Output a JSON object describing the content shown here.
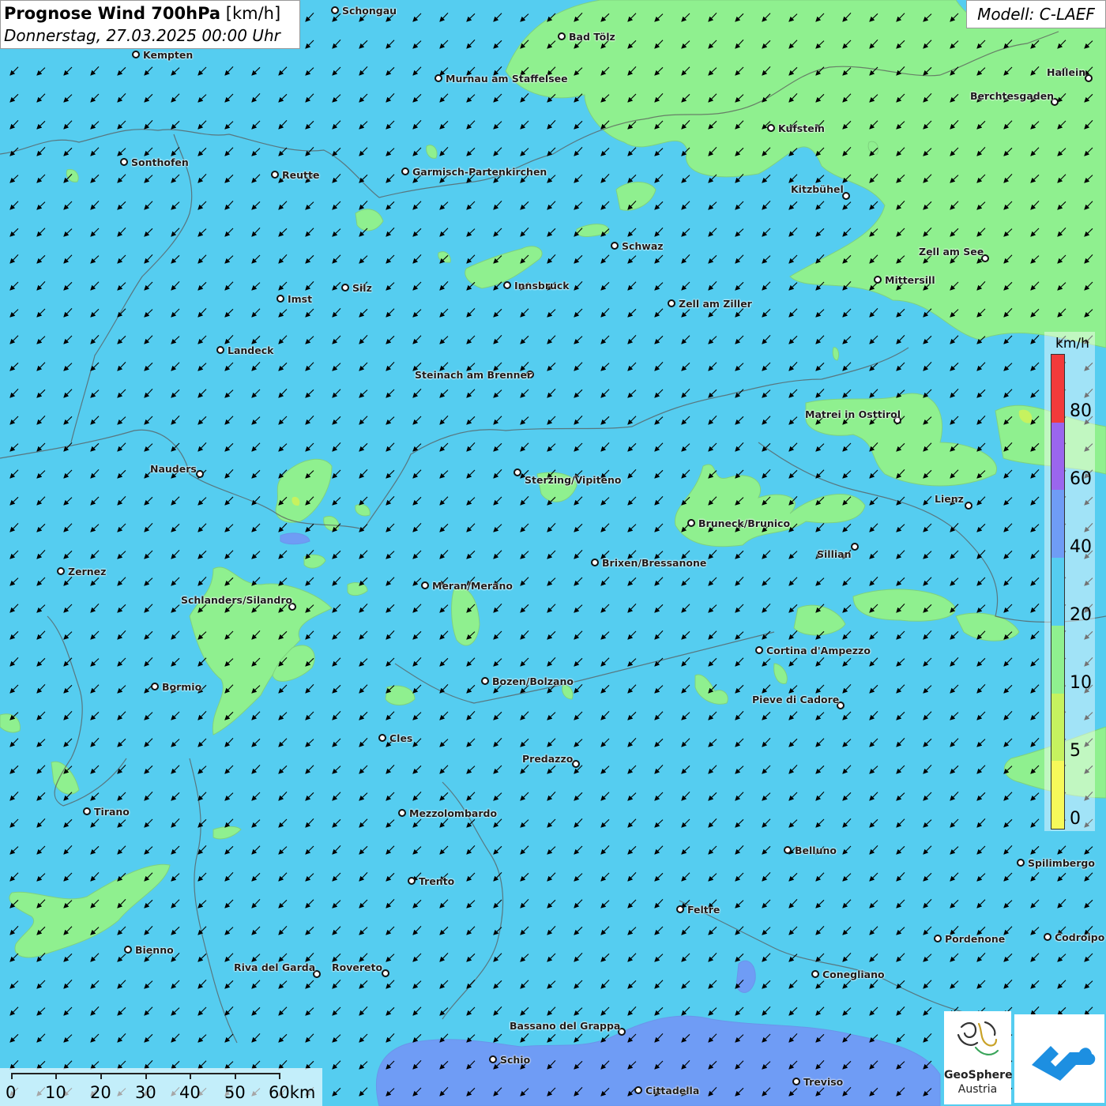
{
  "header": {
    "title": "Prognose Wind 700hPa",
    "unit": "[km/h]",
    "datetime": "Donnerstag, 27.03.2025 00:00 Uhr"
  },
  "model_label": "Modell: C-LAEF",
  "legend": {
    "unit": "km/h",
    "labels": [
      "80",
      "60",
      "40",
      "20",
      "10",
      "5",
      "0"
    ],
    "classes": [
      {
        "from": 0,
        "to": 5,
        "color": "#f6f95a"
      },
      {
        "from": 5,
        "to": 10,
        "color": "#c6f25f"
      },
      {
        "from": 10,
        "to": 20,
        "color": "#8ff08f"
      },
      {
        "from": 20,
        "to": 40,
        "color": "#55cdf0"
      },
      {
        "from": 40,
        "to": 60,
        "color": "#6f9cf5"
      },
      {
        "from": 60,
        "to": 80,
        "color": "#9a66ee"
      },
      {
        "from": 80,
        "to": 100,
        "color": "#f23a3a"
      }
    ]
  },
  "wind": {
    "background_class_kmh": "20-40",
    "prevailing_direction": "from north-east (arrows pointing south-west)"
  },
  "cities": [
    {
      "name": "Schongau"
    },
    {
      "name": "Bad Tölz"
    },
    {
      "name": "Kempten"
    },
    {
      "name": "Murnau am Staffelsee"
    },
    {
      "name": "Hallein"
    },
    {
      "name": "Berchtesgaden"
    },
    {
      "name": "Kufstein"
    },
    {
      "name": "Sonthofen"
    },
    {
      "name": "Reutte"
    },
    {
      "name": "Garmisch-Partenkirchen"
    },
    {
      "name": "Kitzbühel"
    },
    {
      "name": "Schwaz"
    },
    {
      "name": "Zell am See"
    },
    {
      "name": "Mittersill"
    },
    {
      "name": "Innsbruck"
    },
    {
      "name": "Silz"
    },
    {
      "name": "Imst"
    },
    {
      "name": "Zell am Ziller"
    },
    {
      "name": "Landeck"
    },
    {
      "name": "Steinach am Brenner"
    },
    {
      "name": "Matrei in Osttirol"
    },
    {
      "name": "Nauders"
    },
    {
      "name": "Sterzing/Vipiteno"
    },
    {
      "name": "Lienz"
    },
    {
      "name": "Bruneck/Brunico"
    },
    {
      "name": "Sillian"
    },
    {
      "name": "Zernez"
    },
    {
      "name": "Brixen/Bressanone"
    },
    {
      "name": "Meran/Merano"
    },
    {
      "name": "Schlanders/Silandro"
    },
    {
      "name": "Cortina d'Ampezzo"
    },
    {
      "name": "Bozen/Bolzano"
    },
    {
      "name": "Bormio"
    },
    {
      "name": "Pieve di Cadore"
    },
    {
      "name": "Cles"
    },
    {
      "name": "Predazzo"
    },
    {
      "name": "Tirano"
    },
    {
      "name": "Mezzolombardo"
    },
    {
      "name": "Belluno"
    },
    {
      "name": "Spilimbergo"
    },
    {
      "name": "Trento"
    },
    {
      "name": "Feltre"
    },
    {
      "name": "Pordenone"
    },
    {
      "name": "Codroipo"
    },
    {
      "name": "Bienno"
    },
    {
      "name": "Riva del Garda"
    },
    {
      "name": "Rovereto"
    },
    {
      "name": "Conegliano"
    },
    {
      "name": "Bassano del Grappa"
    },
    {
      "name": "Schio"
    },
    {
      "name": "Treviso"
    },
    {
      "name": "Cittadella"
    }
  ],
  "scale": {
    "labels": [
      "0",
      "10",
      "20",
      "30",
      "40",
      "50",
      "60km"
    ]
  },
  "logos": {
    "geosphere_line1": "GeoSphere",
    "geosphere_line2": "Austria",
    "app_icon": "cloud-arrow-app-icon"
  }
}
